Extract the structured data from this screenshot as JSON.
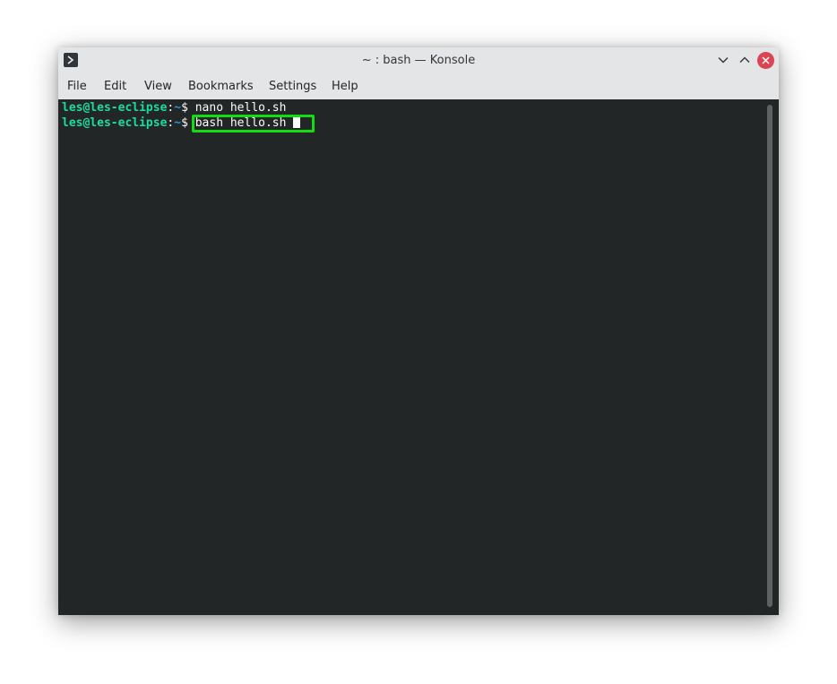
{
  "window": {
    "title": "~ : bash — Konsole"
  },
  "menubar": {
    "items": [
      {
        "label": "File"
      },
      {
        "label": "Edit"
      },
      {
        "label": "View"
      },
      {
        "label": "Bookmarks"
      },
      {
        "label": "Settings"
      },
      {
        "label": "Help"
      }
    ]
  },
  "terminal": {
    "lines": [
      {
        "user_host": "les@les-eclipse",
        "colon": ":",
        "path": "~",
        "dollar": "$",
        "command": " nano hello.sh"
      },
      {
        "user_host": "les@les-eclipse",
        "colon": ":",
        "path": "~",
        "dollar": "$",
        "command": " bash hello.sh "
      }
    ]
  },
  "icons": {
    "app": "konsole-app-icon",
    "minimize": "chevron-down-icon",
    "maximize": "chevron-up-icon",
    "close": "close-icon"
  },
  "colors": {
    "terminal_bg": "#232627",
    "prompt_user": "#1cdc9a",
    "prompt_path": "#1d99f3",
    "highlight_box": "#12dc12",
    "close_button": "#da4453"
  }
}
